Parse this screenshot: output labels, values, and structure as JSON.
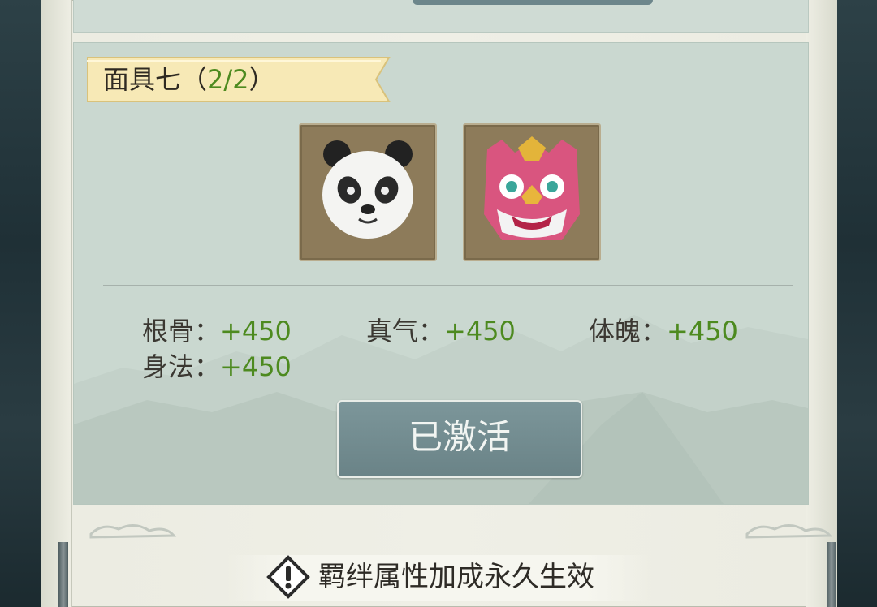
{
  "set": {
    "name": "面具七",
    "progress_open": "（",
    "progress": "2/2",
    "progress_close": "）"
  },
  "masks": [
    {
      "name": "panda-mask",
      "icon": "panda-mask-icon"
    },
    {
      "name": "lion-dance-mask",
      "icon": "lion-mask-icon"
    }
  ],
  "stats": [
    {
      "label": "根骨：",
      "value": "+450"
    },
    {
      "label": "真气：",
      "value": "+450"
    },
    {
      "label": "体魄：",
      "value": "+450"
    },
    {
      "label": "身法：",
      "value": "+450"
    }
  ],
  "activate_button": {
    "label": "已激活"
  },
  "notice": {
    "text": "羁绊属性加成永久生效",
    "icon": "warning-icon"
  },
  "colors": {
    "accent_green": "#4d8a1f",
    "button": "#6f888c",
    "ribbon": "#f7e9b6"
  }
}
